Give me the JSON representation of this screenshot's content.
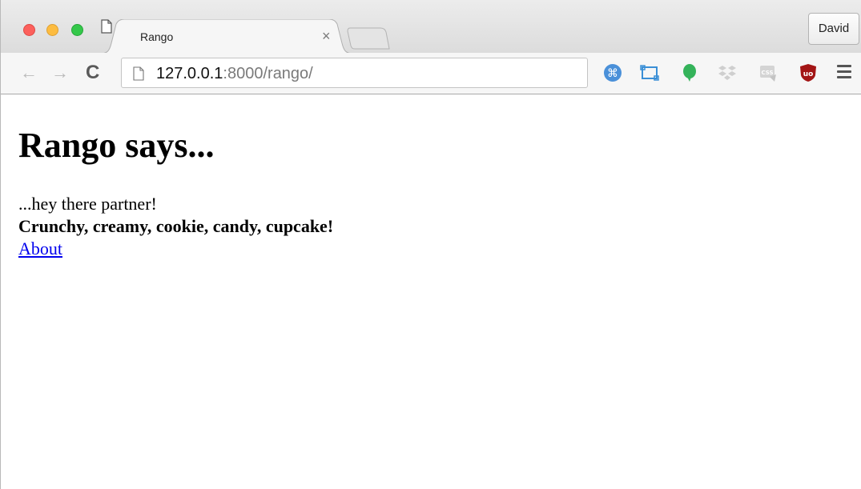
{
  "browser": {
    "tab_title": "Rango",
    "tab_close": "×",
    "profile_name": "David",
    "url_host": "127.0.0.1",
    "url_path": ":8000/rango/",
    "nav": {
      "back": "←",
      "forward": "→",
      "reload": "C"
    },
    "extension_icons": [
      "command-icon",
      "screenshot-icon",
      "evernote-icon",
      "dropbox-icon",
      "css-viewer-icon",
      "ublock-icon"
    ],
    "colors": {
      "close": "#fc605c",
      "minimize": "#fdbc40",
      "maximize": "#34c84a"
    }
  },
  "page": {
    "heading": "Rango says...",
    "greeting": "...hey there partner!",
    "bold_line": "Crunchy, creamy, cookie, candy, cupcake!",
    "link_label": "About",
    "link_color": "#0000ee"
  }
}
